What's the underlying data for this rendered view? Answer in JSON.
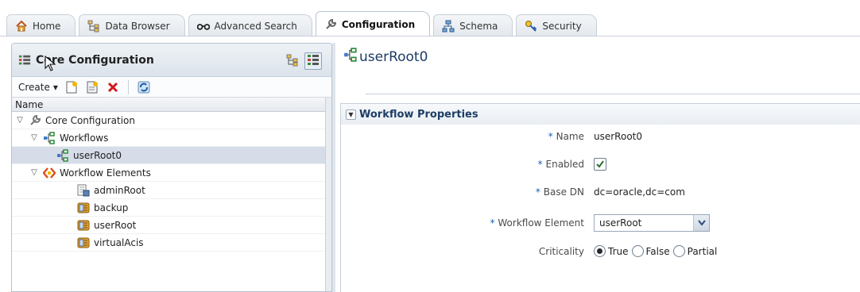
{
  "tabs": [
    {
      "label": "Home",
      "icon": "home-icon"
    },
    {
      "label": "Data Browser",
      "icon": "data-browser-icon"
    },
    {
      "label": "Advanced Search",
      "icon": "glasses-icon"
    },
    {
      "label": "Configuration",
      "icon": "wrench-icon",
      "active": true
    },
    {
      "label": "Schema",
      "icon": "schema-icon"
    },
    {
      "label": "Security",
      "icon": "key-icon"
    }
  ],
  "left_panel": {
    "title": "Core Configuration",
    "toolbar": {
      "create_label": "Create"
    },
    "column_header": "Name",
    "tree": [
      {
        "label": "Core Configuration",
        "icon": "wrench-icon",
        "level": 0,
        "expanded": true
      },
      {
        "label": "Workflows",
        "icon": "workflow-icon",
        "level": 1,
        "expanded": true
      },
      {
        "label": "userRoot0",
        "icon": "workflow-icon",
        "level": 2,
        "selected": true
      },
      {
        "label": "Workflow Elements",
        "icon": "workflow-element-icon",
        "level": 1,
        "expanded": true
      },
      {
        "label": "adminRoot",
        "icon": "backend-icon",
        "level": 2
      },
      {
        "label": "backup",
        "icon": "database-icon",
        "level": 2
      },
      {
        "label": "userRoot",
        "icon": "database-icon",
        "level": 2
      },
      {
        "label": "virtualAcis",
        "icon": "database-icon",
        "level": 2
      }
    ]
  },
  "detail": {
    "title": "userRoot0",
    "section_title": "Workflow Properties",
    "fields": {
      "name_label": "Name",
      "name_value": "userRoot0",
      "enabled_label": "Enabled",
      "base_dn_label": "Base DN",
      "base_dn_value": "dc=oracle,dc=com",
      "workflow_element_label": "Workflow Element",
      "workflow_element_value": "userRoot",
      "criticality_label": "Criticality",
      "criticality_options": [
        "True",
        "False",
        "Partial"
      ],
      "required_marker": "*"
    }
  },
  "colors": {
    "accent": "#1d3d66",
    "selection": "#d6dde8",
    "border": "#c8d0d9"
  }
}
